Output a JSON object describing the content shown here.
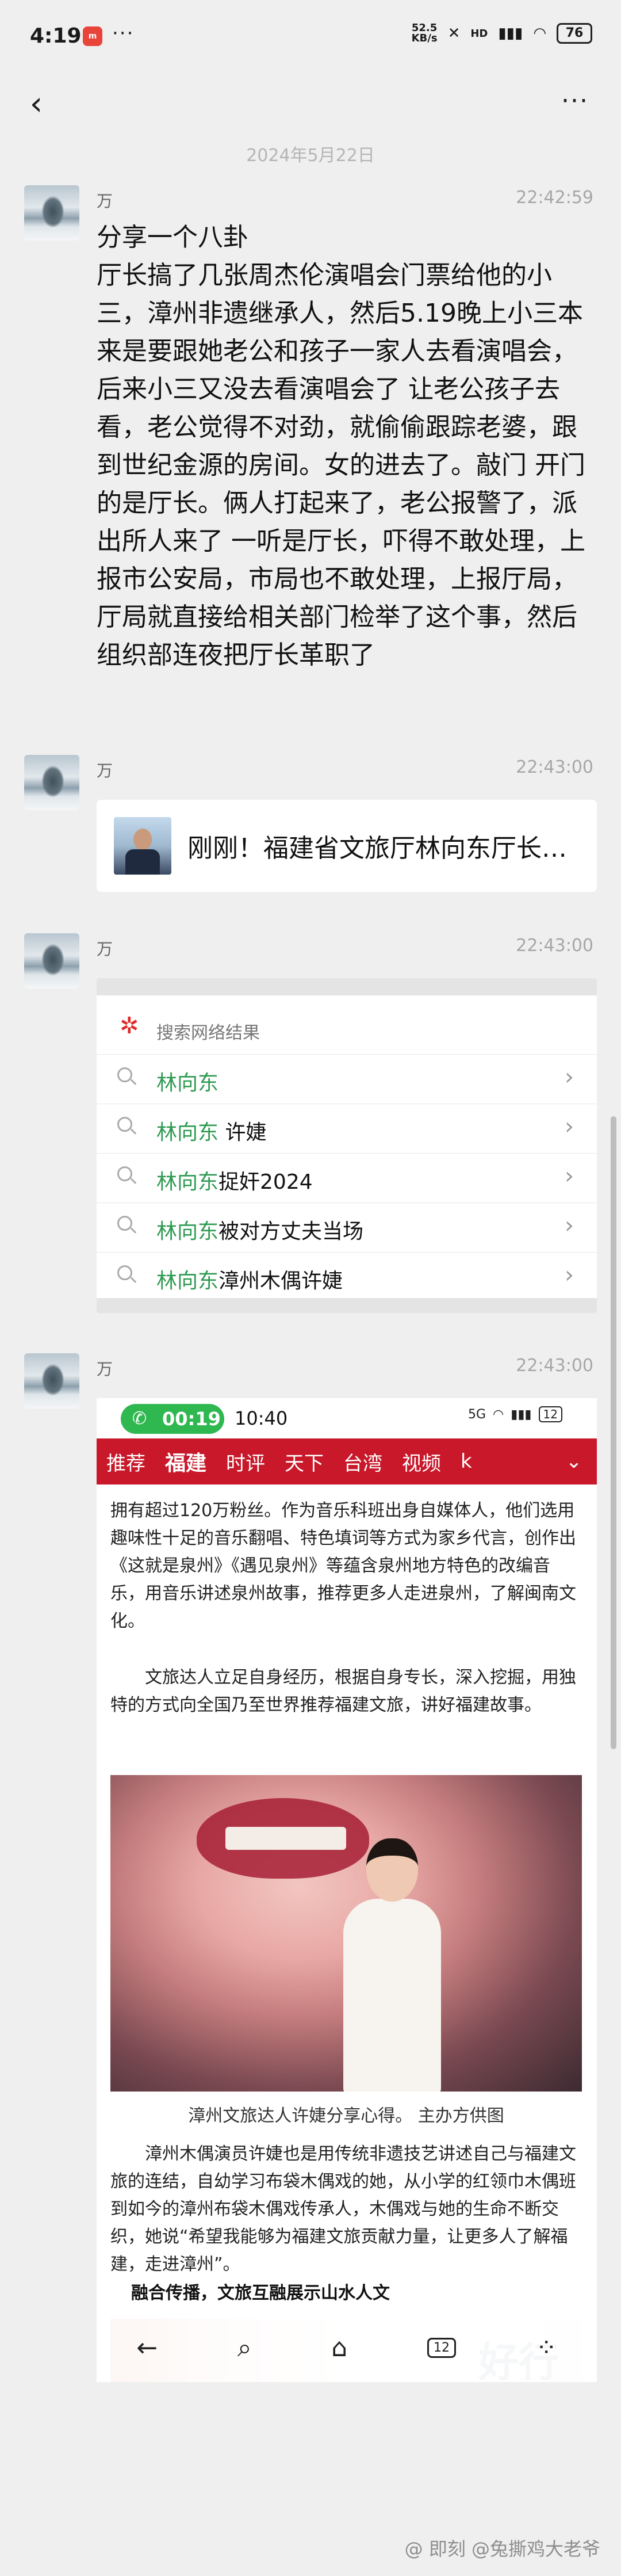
{
  "status_bar": {
    "time": "4:19",
    "app_badge": "m",
    "dots": "···",
    "net_speed_value": "52.5",
    "net_speed_unit": "KB/s",
    "hd_label": "HD",
    "battery": "76"
  },
  "nav": {
    "back_icon": "chevron-left-icon",
    "more_icon": "more-dots-icon"
  },
  "date_divider": "2024年5月22日",
  "messages": [
    {
      "sender": "万",
      "time": "22:42:59",
      "title": "分享一个八卦",
      "body": "厅长搞了几张周杰伦演唱会门票给他的小三，漳州非遗继承人，然后5.19晚上小三本来是要跟她老公和孩子一家人去看演唱会，后来小三又没去看演唱会了 让老公孩子去看，老公觉得不对劲，就偷偷跟踪老婆，跟到世纪金源的房间。女的进去了。敲门 开门的是厅长。俩人打起来了，老公报警了，派出所人来了 一听是厅长，吓得不敢处理，上报市公安局，市局也不敢处理，上报厅局，厅局就直接给相关部门检举了这个事，然后组织部连夜把厅长革职了"
    },
    {
      "sender": "万",
      "time": "22:43:00",
      "link_title": "刚刚！福建省文旅厅林向东厅长…"
    },
    {
      "sender": "万",
      "time": "22:43:00",
      "search_header": "搜索网络结果",
      "search_items": [
        {
          "green": "林向东",
          "rest": ""
        },
        {
          "green": "林向东",
          "rest": " 许婕"
        },
        {
          "green": "林向东",
          "rest": "捉奸2024"
        },
        {
          "green": "林向东",
          "rest": "被对方丈夫当场"
        },
        {
          "green": "林向东",
          "rest": "漳州木偶许婕"
        }
      ]
    },
    {
      "sender": "万",
      "time": "22:43:00",
      "screenshot": {
        "call_time": "00:19",
        "clock": "10:40",
        "signal_label": "5G",
        "battery": "12",
        "categories": [
          "推荐",
          "福建",
          "时评",
          "天下",
          "台湾",
          "视频",
          "k"
        ],
        "para1": "拥有超过120万粉丝。作为音乐科班出身自媒体人，他们选用趣味性十足的音乐翻唱、特色填词等方式为家乡代言，创作出《这就是泉州》《遇见泉州》等蕴含泉州地方特色的改编音乐，用音乐讲述泉州故事，推荐更多人走进泉州，了解闽南文化。",
        "para2": "文旅达人立足自身经历，根据自身专长，深入挖掘，用独特的方式向全国乃至世界推荐福建文旅，讲好福建故事。",
        "caption": "漳州文旅达人许婕分享心得。 主办方供图",
        "para3": "漳州木偶演员许婕也是用传统非遗技艺讲述自己与福建文旅的连结，自幼学习布袋木偶戏的她，从小学的红领巾木偶班到如今的漳州布袋木偶戏传承人，木偶戏与她的生命不断交织，她说“希望我能够为福建文旅贡献力量，让更多人了解福建，走进漳州”。",
        "subhead": "融合传播，文旅互融展示山水人文",
        "nav_tabs": "12"
      }
    }
  ],
  "watermark": "@ 即刻 @兔撕鸡大老爷"
}
